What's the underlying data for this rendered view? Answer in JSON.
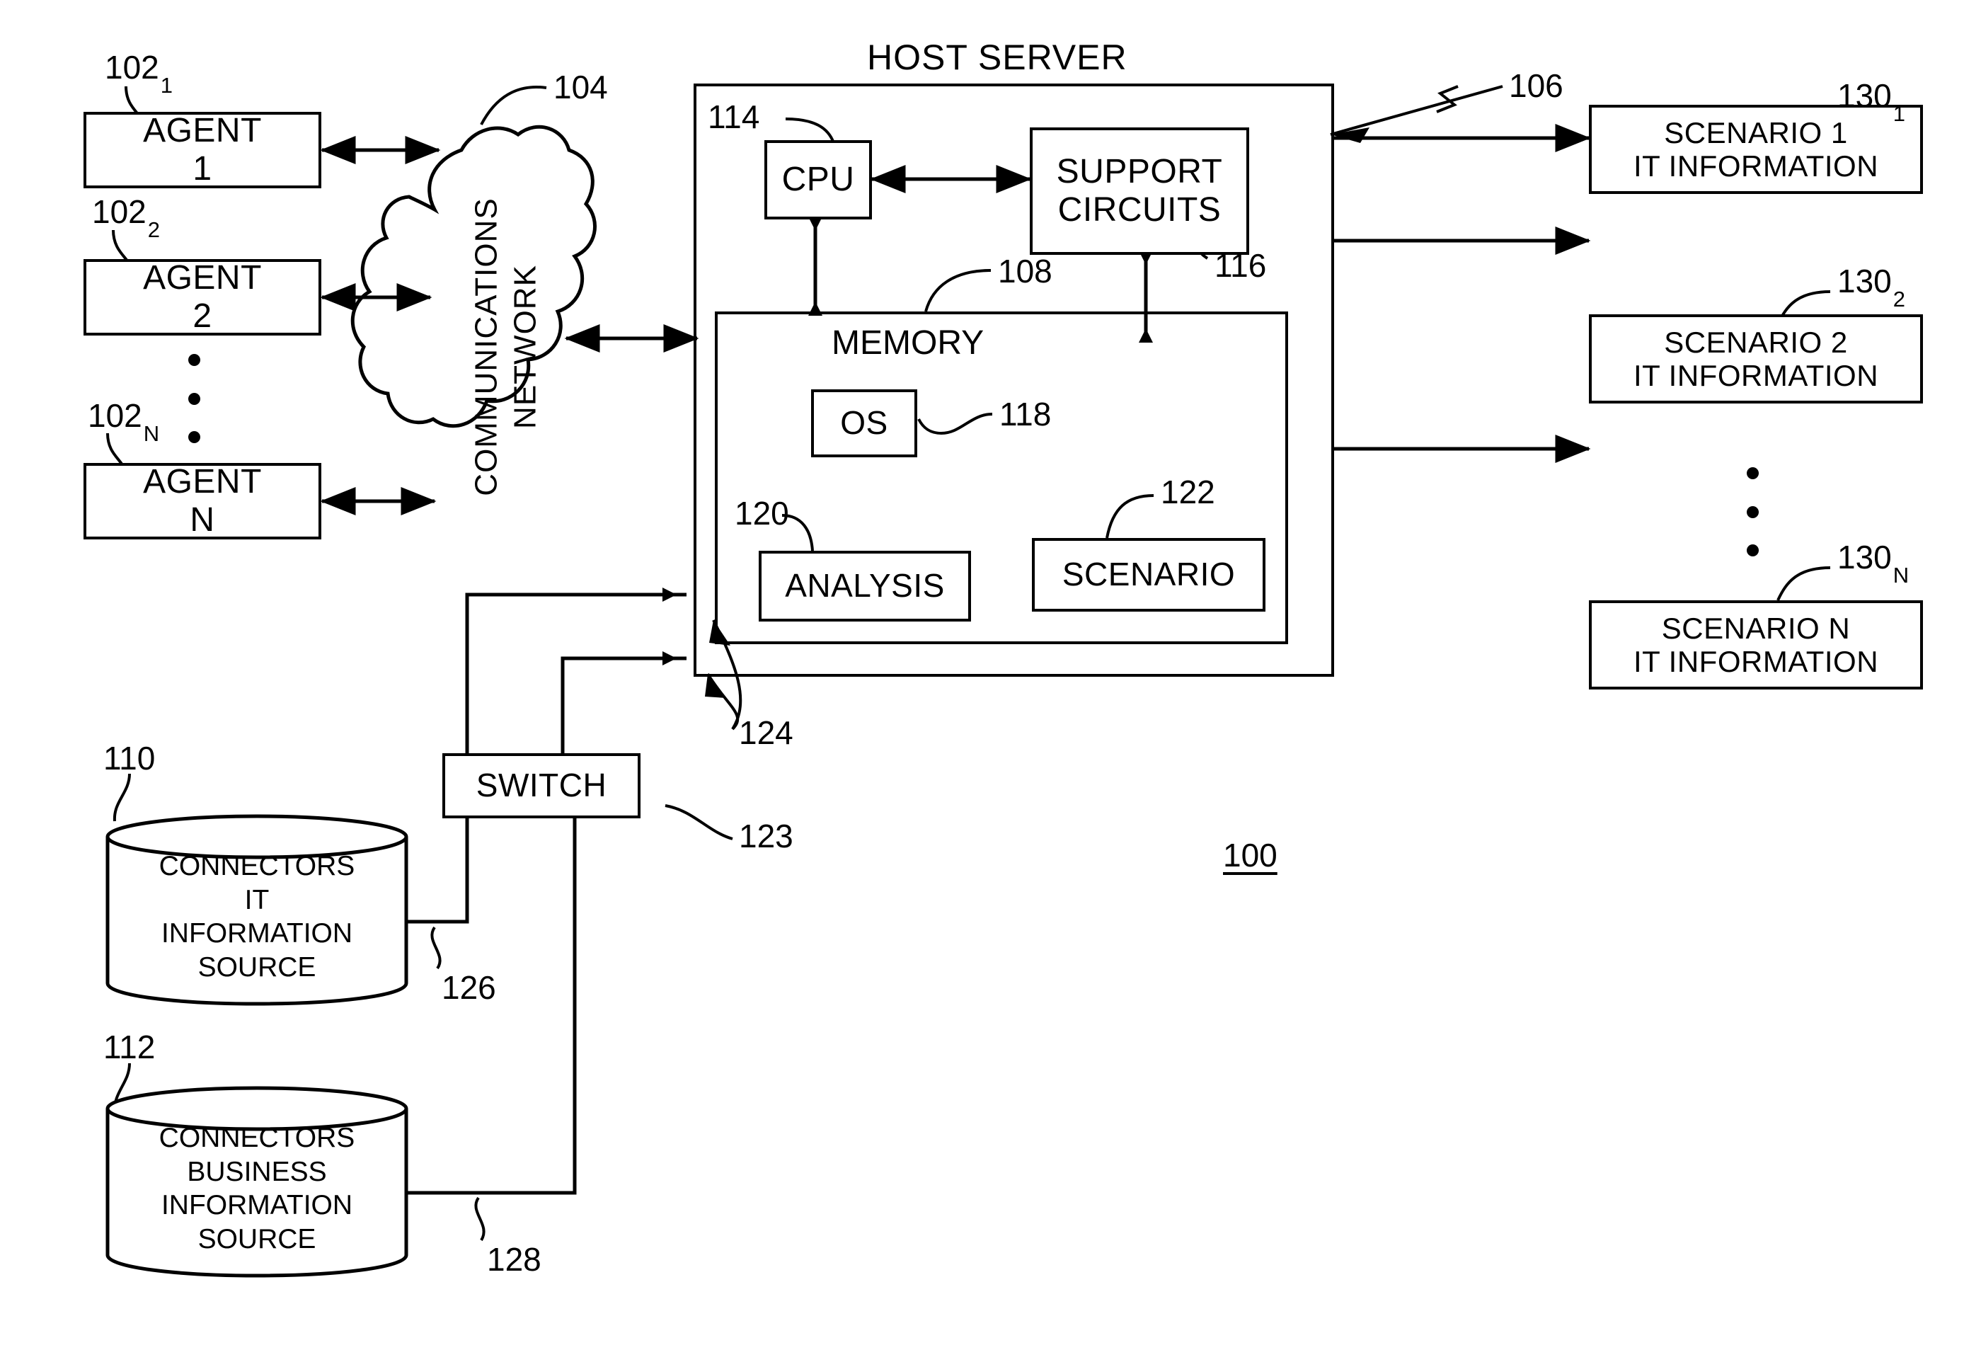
{
  "figure": {
    "system_ref": "100",
    "host_server_title": "HOST SERVER"
  },
  "agents": [
    {
      "label_line1": "AGENT",
      "label_line2": "1",
      "ref": "102",
      "ref_sub": "1"
    },
    {
      "label_line1": "AGENT",
      "label_line2": "2",
      "ref": "102",
      "ref_sub": "2"
    },
    {
      "label_line1": "AGENT",
      "label_line2": "N",
      "ref": "102",
      "ref_sub": "N"
    }
  ],
  "network": {
    "label_line1": "COMMUNICATIONS",
    "label_line2": "NETWORK",
    "ref": "104"
  },
  "host_server": {
    "ref": "106",
    "cpu": {
      "label": "CPU",
      "ref": "114"
    },
    "support_circuits": {
      "label_line1": "SUPPORT",
      "label_line2": "CIRCUITS",
      "ref": "116"
    },
    "memory": {
      "label": "MEMORY",
      "ref": "108",
      "blocks": [
        {
          "label": "OS",
          "ref": "118"
        },
        {
          "label": "ANALYSIS",
          "ref": "120"
        },
        {
          "label": "SCENARIO",
          "ref": "122"
        }
      ]
    },
    "data_links_ref": "124"
  },
  "scenarios": [
    {
      "line1": "SCENARIO 1",
      "line2": "IT INFORMATION",
      "ref": "130",
      "ref_sub": "1"
    },
    {
      "line1": "SCENARIO 2",
      "line2": "IT INFORMATION",
      "ref": "130",
      "ref_sub": "2"
    },
    {
      "line1": "SCENARIO N",
      "line2": "IT INFORMATION",
      "ref": "130",
      "ref_sub": "N"
    }
  ],
  "switch": {
    "label": "SWITCH",
    "ref": "123"
  },
  "sources": [
    {
      "lines": [
        "CONNECTORS",
        "IT",
        "INFORMATION",
        "SOURCE"
      ],
      "ref": "110",
      "link_ref": "126"
    },
    {
      "lines": [
        "CONNECTORS",
        "BUSINESS",
        "INFORMATION",
        "SOURCE"
      ],
      "ref": "112",
      "link_ref": "128"
    }
  ]
}
